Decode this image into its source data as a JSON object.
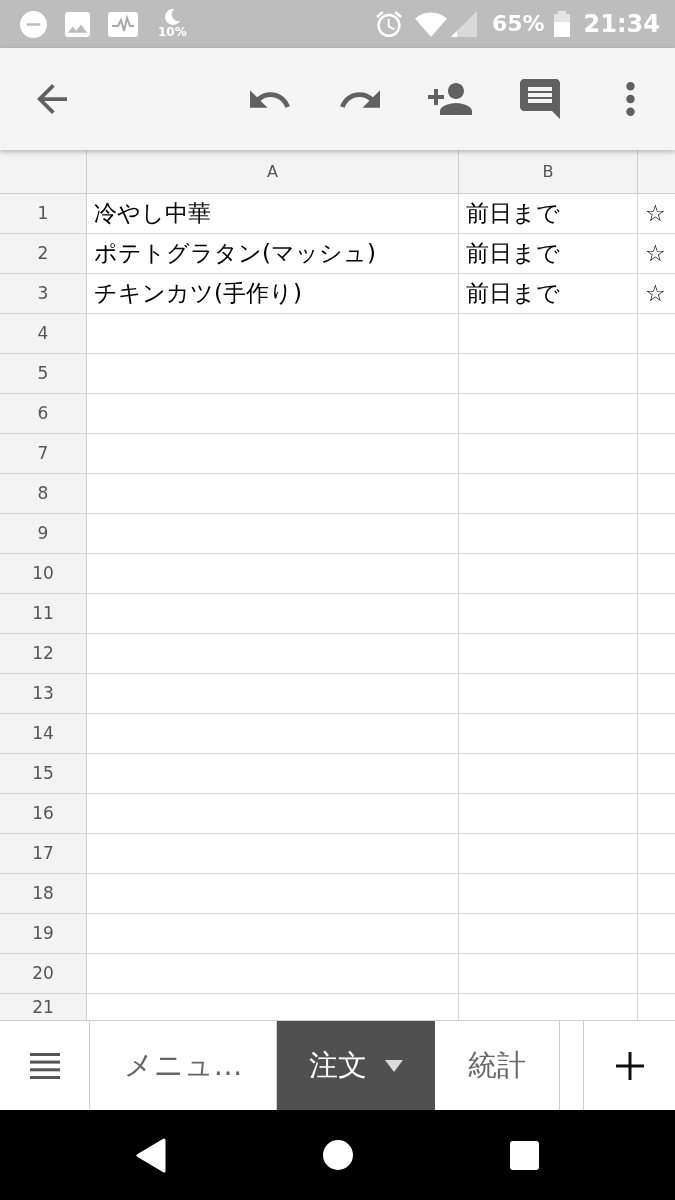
{
  "status_bar": {
    "indicator_text": "10%",
    "battery_percent": "65%",
    "time": "21:34"
  },
  "sheet": {
    "columns": [
      "A",
      "B"
    ],
    "rows": [
      {
        "number": "1",
        "cells": [
          "冷やし中華",
          "前日まで",
          "☆"
        ]
      },
      {
        "number": "2",
        "cells": [
          "ポテトグラタン(マッシュ)",
          "前日まで",
          "☆"
        ]
      },
      {
        "number": "3",
        "cells": [
          "チキンカツ(手作り)",
          "前日まで",
          "☆"
        ]
      },
      {
        "number": "4"
      },
      {
        "number": "5"
      },
      {
        "number": "6"
      },
      {
        "number": "7"
      },
      {
        "number": "8"
      },
      {
        "number": "9"
      },
      {
        "number": "10"
      },
      {
        "number": "11"
      },
      {
        "number": "12"
      },
      {
        "number": "13"
      },
      {
        "number": "14"
      },
      {
        "number": "15"
      },
      {
        "number": "16"
      },
      {
        "number": "17"
      },
      {
        "number": "18"
      },
      {
        "number": "19"
      },
      {
        "number": "20"
      },
      {
        "number": "21"
      }
    ]
  },
  "sheet_tabs": [
    {
      "label": "メニュ…",
      "selected": false
    },
    {
      "label": "注文",
      "selected": true
    },
    {
      "label": "統計",
      "selected": false
    }
  ]
}
